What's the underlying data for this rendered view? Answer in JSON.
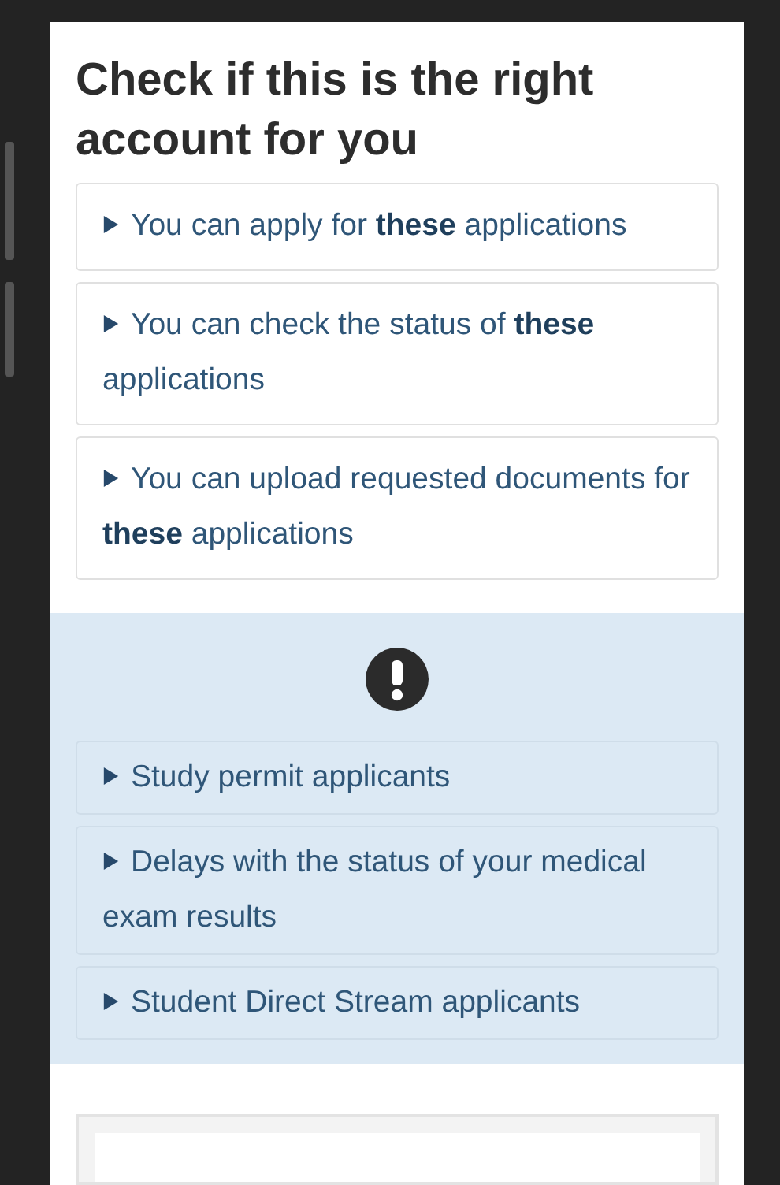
{
  "heading": "Check if this is the right account for you",
  "account_items": [
    {
      "text": "You can apply for **these** applications",
      "expanded": false
    },
    {
      "text": "You can check the status of **these** applications",
      "expanded": false
    },
    {
      "text": "You can upload requested documents for **these** applications",
      "expanded": false
    }
  ],
  "notice": {
    "items": [
      {
        "text": "Study permit applicants",
        "expanded": false
      },
      {
        "text": "Delays with the status of your medical exam results",
        "expanded": false
      },
      {
        "text": "Student Direct Stream applicants",
        "expanded": false
      }
    ]
  }
}
